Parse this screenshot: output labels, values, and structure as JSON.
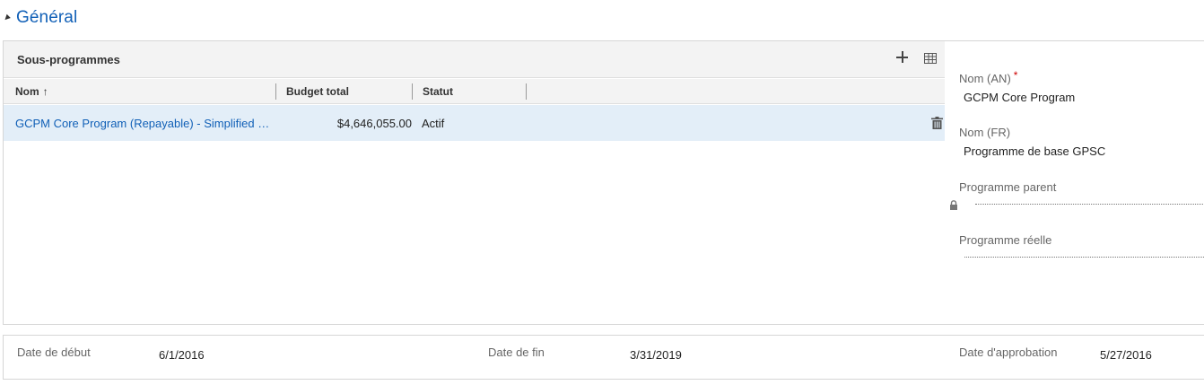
{
  "section": {
    "title": "Général"
  },
  "subgrid": {
    "title": "Sous-programmes",
    "columns": [
      {
        "label": "Nom",
        "sort": "↑"
      },
      {
        "label": "Budget total"
      },
      {
        "label": "Statut"
      }
    ],
    "rows": [
      {
        "name": "GCPM Core Program (Repayable) - Simplified Stream",
        "budget": "$4,646,055.00",
        "status": "Actif"
      }
    ]
  },
  "form": {
    "nom_an": {
      "label": "Nom (AN)",
      "required": "*",
      "value": "GCPM Core Program"
    },
    "nom_fr": {
      "label": "Nom (FR)",
      "value": "Programme de base GPSC"
    },
    "programme_parent": {
      "label": "Programme parent",
      "value": ""
    },
    "programme_reelle": {
      "label": "Programme réelle",
      "value": ""
    }
  },
  "dates": {
    "debut": {
      "label": "Date de début",
      "value": "6/1/2016"
    },
    "fin": {
      "label": "Date de fin",
      "value": "3/31/2019"
    },
    "approbation": {
      "label": "Date d'approbation",
      "value": "5/27/2016"
    }
  }
}
